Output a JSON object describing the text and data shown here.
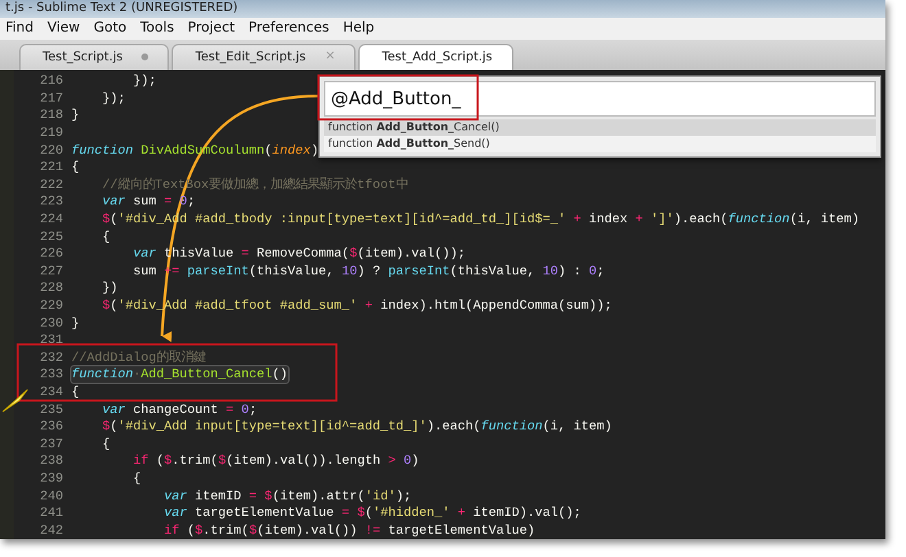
{
  "window": {
    "title": "t.js - Sublime Text 2 (UNREGISTERED)"
  },
  "menu": [
    "Find",
    "View",
    "Goto",
    "Tools",
    "Project",
    "Preferences",
    "Help"
  ],
  "tabs": [
    {
      "label": "Test_Script.js",
      "selected": false,
      "modified": true
    },
    {
      "label": "Test_Edit_Script.js",
      "selected": false,
      "modified": false,
      "close": "×"
    },
    {
      "label": "Test_Add_Script.js",
      "selected": true,
      "modified": false
    }
  ],
  "goto_symbol": {
    "value": "@Add_Button_",
    "results": [
      {
        "label": "function **Add_Button_**Cancel()",
        "selected": true
      },
      {
        "label": "function **Add_Button_**Send()",
        "selected": false
      }
    ]
  },
  "lines": [
    {
      "number": "216",
      "tokens": [
        {
          "kind": "plain",
          "text": "        });"
        }
      ]
    },
    {
      "number": "217",
      "tokens": [
        {
          "kind": "plain",
          "text": "    });"
        }
      ]
    },
    {
      "number": "218",
      "tokens": [
        {
          "kind": "plain",
          "text": "}"
        }
      ]
    },
    {
      "number": "219"
    },
    {
      "number": "220",
      "tokens": [
        {
          "kind": "keyword",
          "text": "function "
        },
        {
          "kind": "function",
          "text": "DivAddSumCoulumn"
        },
        {
          "kind": "plain",
          "text": "("
        },
        {
          "kind": "parameter",
          "text": "index"
        },
        {
          "kind": "plain",
          "text": ")"
        }
      ]
    },
    {
      "number": "221",
      "tokens": [
        {
          "kind": "plain",
          "text": "{"
        }
      ]
    },
    {
      "number": "222",
      "tokens": [
        {
          "kind": "comment",
          "text": "    //縱向的TextBox要做加總，加總結果顯示於tfoot中"
        }
      ]
    },
    {
      "number": "223",
      "tokens": [
        {
          "kind": "keyword",
          "text": "    var"
        },
        {
          "kind": "plain",
          "text": " sum "
        },
        {
          "kind": "operator",
          "text": "="
        },
        {
          "kind": "number",
          "text": " 0"
        },
        {
          "kind": "plain",
          "text": ";"
        }
      ]
    },
    {
      "number": "224",
      "tokens": [
        {
          "kind": "operator",
          "text": "    $"
        },
        {
          "kind": "plain",
          "text": "("
        },
        {
          "kind": "string",
          "text": "'#div_Add #add_tbody :input[type=text][id^=add_td_][id$=_'"
        },
        {
          "kind": "operator",
          "text": " +"
        },
        {
          "kind": "plain",
          "text": " index "
        },
        {
          "kind": "operator",
          "text": "+"
        },
        {
          "kind": "string",
          "text": " ']'"
        },
        {
          "kind": "plain",
          "text": ").each("
        },
        {
          "kind": "keyword",
          "text": "function"
        },
        {
          "kind": "plain",
          "text": "(i, item)"
        }
      ]
    },
    {
      "number": "225",
      "tokens": [
        {
          "kind": "plain",
          "text": "    {"
        }
      ]
    },
    {
      "number": "226",
      "tokens": [
        {
          "kind": "keyword",
          "text": "        var"
        },
        {
          "kind": "plain",
          "text": " thisValue "
        },
        {
          "kind": "operator",
          "text": "="
        },
        {
          "kind": "plain",
          "text": " RemoveComma("
        },
        {
          "kind": "operator",
          "text": "$"
        },
        {
          "kind": "plain",
          "text": "(item).val());"
        }
      ]
    },
    {
      "number": "227",
      "tokens": [
        {
          "kind": "plain",
          "text": "        sum "
        },
        {
          "kind": "operator",
          "text": "+="
        },
        {
          "kind": "builtin",
          "text": " parseInt"
        },
        {
          "kind": "plain",
          "text": "(thisValue, "
        },
        {
          "kind": "number",
          "text": "10"
        },
        {
          "kind": "plain",
          "text": ") ? "
        },
        {
          "kind": "builtin",
          "text": "parseInt"
        },
        {
          "kind": "plain",
          "text": "(thisValue, "
        },
        {
          "kind": "number",
          "text": "10"
        },
        {
          "kind": "plain",
          "text": ") : "
        },
        {
          "kind": "number",
          "text": "0"
        },
        {
          "kind": "plain",
          "text": ";"
        }
      ]
    },
    {
      "number": "228",
      "tokens": [
        {
          "kind": "plain",
          "text": "    })"
        }
      ]
    },
    {
      "number": "229",
      "tokens": [
        {
          "kind": "operator",
          "text": "    $"
        },
        {
          "kind": "plain",
          "text": "("
        },
        {
          "kind": "string",
          "text": "'#div_Add #add_tfoot #add_sum_'"
        },
        {
          "kind": "operator",
          "text": " +"
        },
        {
          "kind": "plain",
          "text": " index).html(AppendComma(sum));"
        }
      ]
    },
    {
      "number": "230",
      "tokens": [
        {
          "kind": "plain",
          "text": "}"
        }
      ]
    },
    {
      "number": "231"
    },
    {
      "number": "232",
      "tokens": [
        {
          "kind": "comment",
          "text": "//AddDialog的取消鍵"
        }
      ]
    },
    {
      "number": "233",
      "highlighted": true,
      "tokens": [
        {
          "kind": "keyword",
          "text": "function"
        },
        {
          "kind": "comment",
          "text": "·"
        },
        {
          "kind": "function",
          "text": "Add_Button_Cancel"
        },
        {
          "kind": "plain",
          "text": "()"
        }
      ]
    },
    {
      "number": "234",
      "tokens": [
        {
          "kind": "plain",
          "text": "{"
        }
      ]
    },
    {
      "number": "235",
      "tokens": [
        {
          "kind": "keyword",
          "text": "    var"
        },
        {
          "kind": "plain",
          "text": " changeCount "
        },
        {
          "kind": "operator",
          "text": "="
        },
        {
          "kind": "number",
          "text": " 0"
        },
        {
          "kind": "plain",
          "text": ";"
        }
      ]
    },
    {
      "number": "236",
      "tokens": [
        {
          "kind": "operator",
          "text": "    $"
        },
        {
          "kind": "plain",
          "text": "("
        },
        {
          "kind": "string",
          "text": "'#div_Add input[type=text][id^=add_td_]'"
        },
        {
          "kind": "plain",
          "text": ").each("
        },
        {
          "kind": "keyword",
          "text": "function"
        },
        {
          "kind": "plain",
          "text": "(i, item)"
        }
      ]
    },
    {
      "number": "237",
      "tokens": [
        {
          "kind": "plain",
          "text": "    {"
        }
      ]
    },
    {
      "number": "238",
      "tokens": [
        {
          "kind": "operator",
          "text": "        if"
        },
        {
          "kind": "plain",
          "text": " ("
        },
        {
          "kind": "operator",
          "text": "$"
        },
        {
          "kind": "plain",
          "text": ".trim("
        },
        {
          "kind": "operator",
          "text": "$"
        },
        {
          "kind": "plain",
          "text": "(item).val()).length "
        },
        {
          "kind": "operator",
          "text": ">"
        },
        {
          "kind": "number",
          "text": " 0"
        },
        {
          "kind": "plain",
          "text": ")"
        }
      ]
    },
    {
      "number": "239",
      "tokens": [
        {
          "kind": "plain",
          "text": "        {"
        }
      ]
    },
    {
      "number": "240",
      "tokens": [
        {
          "kind": "keyword",
          "text": "            var"
        },
        {
          "kind": "plain",
          "text": " itemID "
        },
        {
          "kind": "operator",
          "text": "="
        },
        {
          "kind": "operator",
          "text": " $"
        },
        {
          "kind": "plain",
          "text": "(item).attr("
        },
        {
          "kind": "string",
          "text": "'id'"
        },
        {
          "kind": "plain",
          "text": ");"
        }
      ]
    },
    {
      "number": "241",
      "tokens": [
        {
          "kind": "keyword",
          "text": "            var"
        },
        {
          "kind": "plain",
          "text": " targetElementValue "
        },
        {
          "kind": "operator",
          "text": "="
        },
        {
          "kind": "operator",
          "text": " $"
        },
        {
          "kind": "plain",
          "text": "("
        },
        {
          "kind": "string",
          "text": "'#hidden_'"
        },
        {
          "kind": "operator",
          "text": " +"
        },
        {
          "kind": "plain",
          "text": " itemID).val();"
        }
      ]
    },
    {
      "number": "242",
      "tokens": [
        {
          "kind": "operator",
          "text": "            if"
        },
        {
          "kind": "plain",
          "text": " ("
        },
        {
          "kind": "operator",
          "text": "$"
        },
        {
          "kind": "plain",
          "text": ".trim("
        },
        {
          "kind": "operator",
          "text": "$"
        },
        {
          "kind": "plain",
          "text": "(item).val()) "
        },
        {
          "kind": "operator",
          "text": "!="
        },
        {
          "kind": "plain",
          "text": " targetElementValue)"
        }
      ]
    }
  ]
}
